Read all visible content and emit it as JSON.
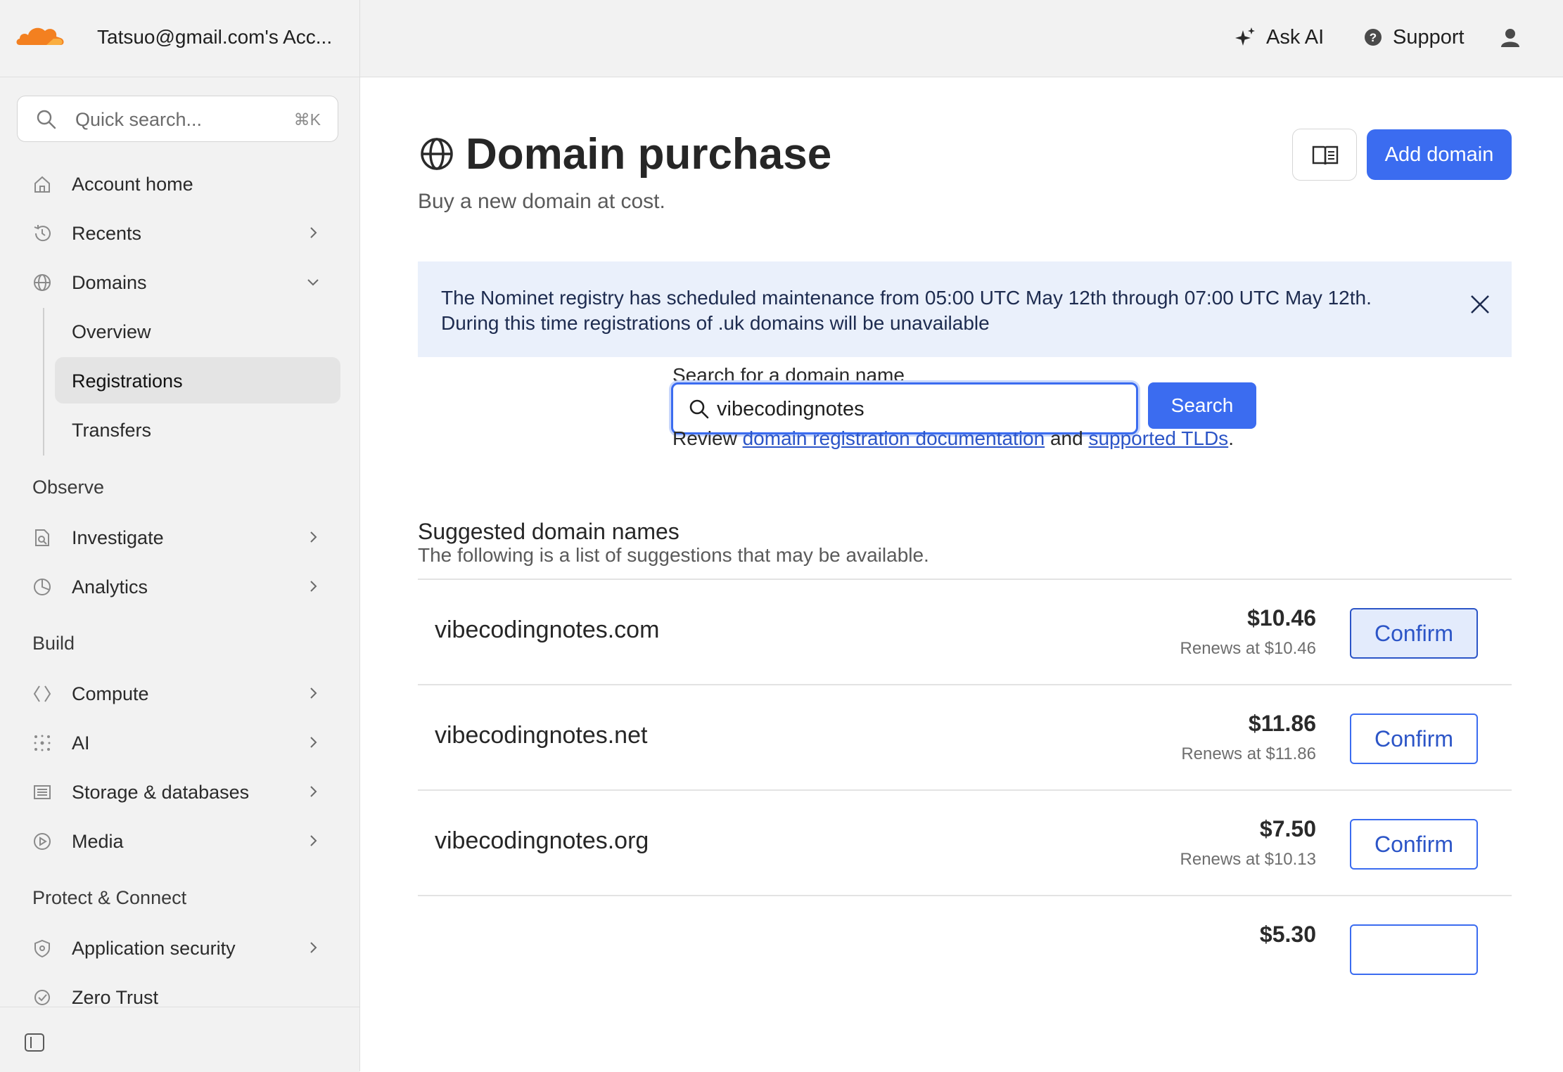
{
  "account": {
    "name": "Tatsuo@gmail.com's Acc..."
  },
  "search": {
    "placeholder": "Quick search...",
    "shortcut": "⌘K"
  },
  "sidebar": {
    "items": [
      {
        "label": "Account home"
      },
      {
        "label": "Recents"
      },
      {
        "label": "Domains"
      }
    ],
    "domains_sub": [
      {
        "label": "Overview"
      },
      {
        "label": "Registrations"
      },
      {
        "label": "Transfers"
      }
    ],
    "sections": {
      "observe": "Observe",
      "build": "Build",
      "protect": "Protect & Connect"
    },
    "observe_items": [
      {
        "label": "Investigate"
      },
      {
        "label": "Analytics"
      }
    ],
    "build_items": [
      {
        "label": "Compute"
      },
      {
        "label": "AI"
      },
      {
        "label": "Storage & databases"
      },
      {
        "label": "Media"
      }
    ],
    "protect_items": [
      {
        "label": "Application security"
      },
      {
        "label": "Zero Trust"
      }
    ]
  },
  "topbar": {
    "ask_ai": "Ask AI",
    "support": "Support"
  },
  "page": {
    "title": "Domain purchase",
    "subtitle": "Buy a new domain at cost.",
    "add_button": "Add domain"
  },
  "notice": {
    "line1": "The Nominet registry has scheduled maintenance from 05:00 UTC May 12th through 07:00 UTC May 12th.",
    "line2": "During this time registrations of .uk domains will be unavailable"
  },
  "domain_search": {
    "label": "Search for a domain name",
    "value": "vibecodingnotes",
    "button": "Search",
    "review_prefix": "Review ",
    "link1": "domain registration documentation",
    "and": " and ",
    "link2": "supported TLDs",
    "suffix": "."
  },
  "suggestions": {
    "title": "Suggested domain names",
    "subtitle": "The following is a list of suggestions that may be available.",
    "rows": [
      {
        "domain": "vibecodingnotes.com",
        "price": "$10.46",
        "renew": "Renews at $10.46",
        "button": "Confirm"
      },
      {
        "domain": "vibecodingnotes.net",
        "price": "$11.86",
        "renew": "Renews at $11.86",
        "button": "Confirm"
      },
      {
        "domain": "vibecodingnotes.org",
        "price": "$7.50",
        "renew": "Renews at $10.13",
        "button": "Confirm"
      },
      {
        "domain": "",
        "price": "$5.30",
        "renew": "",
        "button": ""
      }
    ]
  },
  "colors": {
    "accent": "#3b6cf0",
    "brand_orange": "#f38020",
    "notice_bg": "#eaf0fb"
  }
}
